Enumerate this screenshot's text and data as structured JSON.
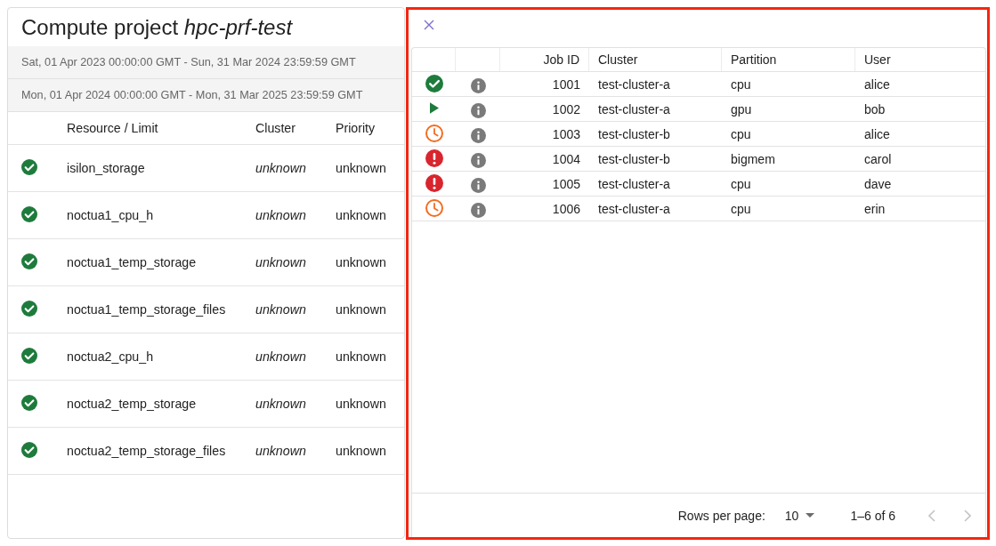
{
  "project": {
    "title": "Compute project *hpc-prf-test*",
    "periods": [
      "Sat, 01 Apr 2023 00:00:00 GMT - Sun, 31 Mar 2024 23:59:59 GMT",
      "Mon, 01 Apr 2024 00:00:00 GMT - Mon, 31 Mar 2025 23:59:59 GMT"
    ],
    "table": {
      "columns": [
        {
          "label": "Resource / Limit"
        },
        {
          "label": "Cluster"
        },
        {
          "label": "Priority"
        }
      ],
      "rows": [
        {
          "kind": "ok",
          "cells": [
            "isilon_storage",
            "unknown",
            "unknown"
          ]
        },
        {
          "kind": "ok",
          "cells": [
            "noctua1_cpu_h",
            "unknown",
            "unknown"
          ]
        },
        {
          "kind": "ok",
          "cells": [
            "noctua1_temp_storage",
            "unknown",
            "unknown"
          ]
        },
        {
          "kind": "ok",
          "cells": [
            "noctua1_temp_storage_files",
            "unknown",
            "unknown"
          ]
        },
        {
          "kind": "ok",
          "cells": [
            "noctua2_cpu_h",
            "unknown",
            "unknown"
          ]
        },
        {
          "kind": "ok",
          "cells": [
            "noctua2_temp_storage",
            "unknown",
            "unknown"
          ]
        },
        {
          "kind": "ok",
          "cells": [
            "noctua2_temp_storage_files",
            "unknown",
            "unknown"
          ]
        }
      ]
    }
  },
  "jobs": {
    "columns": [
      {
        "label": "Job ID",
        "kind": "number"
      },
      {
        "label": "Cluster",
        "kind": "text"
      },
      {
        "label": "Partition",
        "kind": "text"
      },
      {
        "label": "User",
        "kind": "text"
      }
    ],
    "rows": [
      {
        "kind": "completed",
        "cells": [
          "1001",
          "test-cluster-a",
          "cpu",
          "alice"
        ]
      },
      {
        "kind": "running",
        "cells": [
          "1002",
          "test-cluster-a",
          "gpu",
          "bob"
        ]
      },
      {
        "kind": "pending",
        "cells": [
          "1003",
          "test-cluster-b",
          "cpu",
          "alice"
        ]
      },
      {
        "kind": "failed",
        "cells": [
          "1004",
          "test-cluster-b",
          "bigmem",
          "carol"
        ]
      },
      {
        "kind": "failed",
        "cells": [
          "1005",
          "test-cluster-a",
          "cpu",
          "dave"
        ]
      },
      {
        "kind": "pending",
        "cells": [
          "1006",
          "test-cluster-a",
          "cpu",
          "erin"
        ]
      }
    ],
    "pagination": {
      "rows_per_page_label": "Rows per page:",
      "rows_per_page": "10",
      "range": "1–6 of 6",
      "prev_disabled": true,
      "next_disabled": true
    }
  }
}
